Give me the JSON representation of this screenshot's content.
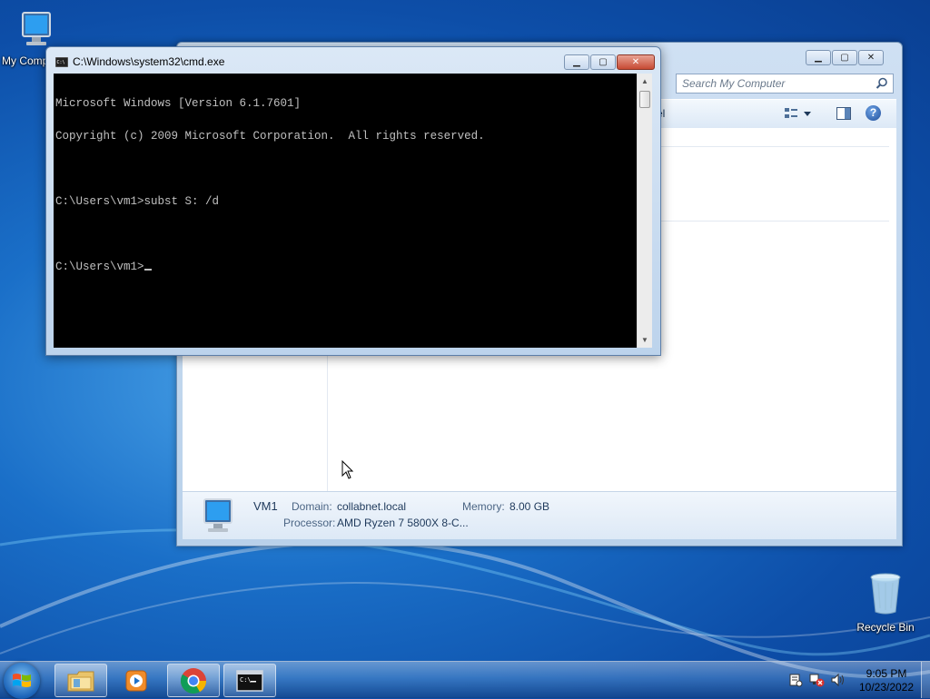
{
  "desktop": {
    "icons": [
      {
        "label": "My Comp"
      },
      {
        "label": "Recycle Bin"
      }
    ]
  },
  "explorer": {
    "search_placeholder": "Search My Computer",
    "toolbar_partial_text": "el",
    "details": {
      "computer_name": "VM1",
      "domain_label": "Domain:",
      "domain_value": "collabnet.local",
      "memory_label": "Memory:",
      "memory_value": "8.00 GB",
      "processor_label": "Processor:",
      "processor_value": "AMD Ryzen 7 5800X 8-C..."
    }
  },
  "cmd": {
    "title": "C:\\Windows\\system32\\cmd.exe",
    "lines": [
      "Microsoft Windows [Version 6.1.7601]",
      "Copyright (c) 2009 Microsoft Corporation.  All rights reserved.",
      "",
      "C:\\Users\\vm1>subst S: /d",
      "",
      "C:\\Users\\vm1>"
    ]
  },
  "taskbar": {
    "buttons": [
      {
        "name": "file-explorer"
      },
      {
        "name": "media-player"
      },
      {
        "name": "chrome"
      },
      {
        "name": "command-prompt"
      }
    ],
    "clock": {
      "time": "9:05 PM",
      "date": "10/23/2022"
    }
  },
  "colors": {
    "desktop_blue": "#1a6fc8",
    "cmd_text": "#c0c0c0",
    "close_red": "#c74a33"
  }
}
